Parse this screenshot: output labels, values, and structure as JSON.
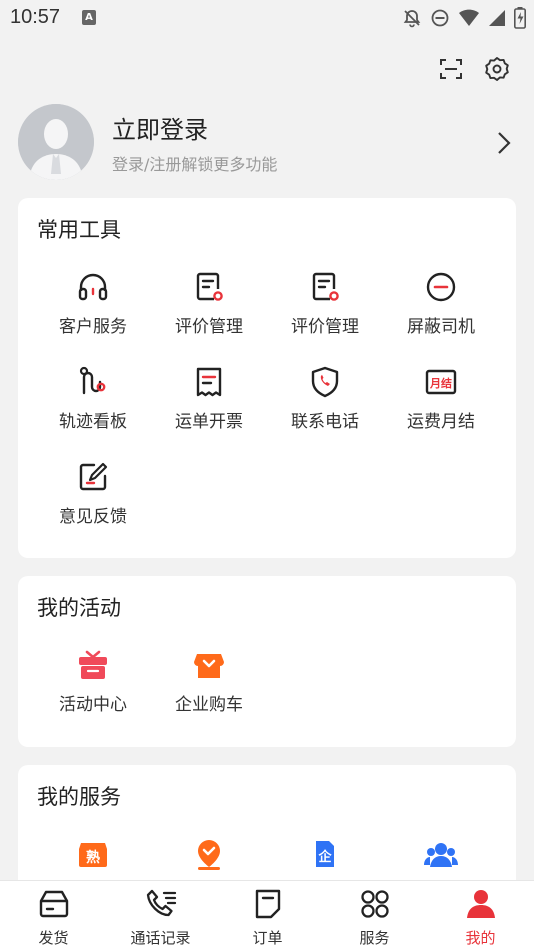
{
  "status_bar": {
    "time": "10:57",
    "app_badge": "A"
  },
  "top_actions": {
    "scan_icon": "scan-icon",
    "settings_icon": "gear-icon"
  },
  "profile": {
    "title": "立即登录",
    "subtitle": "登录/注册解锁更多功能"
  },
  "tools": {
    "title": "常用工具",
    "items": [
      {
        "label": "客户服务",
        "icon": "headset-icon"
      },
      {
        "label": "评价管理",
        "icon": "review-icon"
      },
      {
        "label": "评价管理",
        "icon": "review-icon"
      },
      {
        "label": "屏蔽司机",
        "icon": "block-icon"
      },
      {
        "label": "轨迹看板",
        "icon": "track-icon"
      },
      {
        "label": "运单开票",
        "icon": "invoice-icon"
      },
      {
        "label": "联系电话",
        "icon": "phone-shield-icon"
      },
      {
        "label": "运费月结",
        "icon": "monthly-icon",
        "badge": "月结"
      },
      {
        "label": "意见反馈",
        "icon": "feedback-icon"
      }
    ]
  },
  "activities": {
    "title": "我的活动",
    "items": [
      {
        "label": "活动中心",
        "icon": "gift-icon"
      },
      {
        "label": "企业购车",
        "icon": "shop-icon"
      }
    ]
  },
  "services": {
    "title": "我的服务",
    "items": [
      {
        "icon": "familiar-icon",
        "badge": "熟"
      },
      {
        "icon": "location-icon"
      },
      {
        "icon": "enterprise-icon",
        "badge": "企"
      },
      {
        "icon": "group-icon"
      }
    ]
  },
  "tab_bar": {
    "items": [
      {
        "label": "发货",
        "icon": "box-icon"
      },
      {
        "label": "通话记录",
        "icon": "call-log-icon"
      },
      {
        "label": "订单",
        "icon": "order-icon"
      },
      {
        "label": "服务",
        "icon": "grid-icon"
      },
      {
        "label": "我的",
        "icon": "user-icon",
        "active": true
      }
    ]
  },
  "colors": {
    "accent": "#e8333a",
    "orange": "#ff6a1a",
    "blue": "#2f73f5"
  }
}
